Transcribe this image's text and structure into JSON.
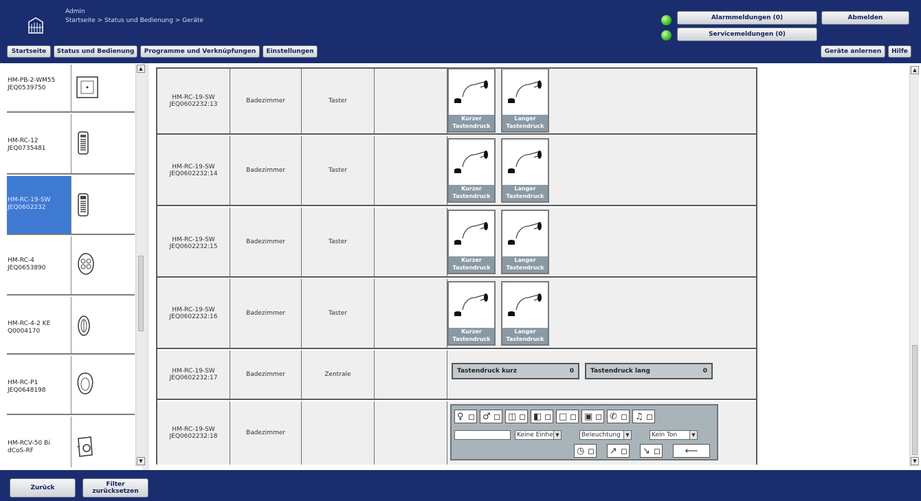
{
  "header": {
    "user": "Admin",
    "breadcrumb": "Startseite > Status und Bedienung > Geräte",
    "alarm_label": "Alarmmeldungen (0)",
    "service_label": "Servicemeldungen (0)",
    "logout_label": "Abmelden",
    "status_color": "#3cbc23"
  },
  "nav": {
    "items": [
      "Startseite",
      "Status und Bedienung",
      "Programme und Verknüpfungen",
      "Einstellungen"
    ],
    "teach_label": "Geräte anlernen",
    "help_label": "Hilfe"
  },
  "devices": [
    {
      "name": "HM-PB-2-WM55\nJEQ0539750",
      "icon": "wall-switch-icon",
      "selected": false
    },
    {
      "name": "HM-RC-12\nJEQ0735481",
      "icon": "remote-12-icon",
      "selected": false
    },
    {
      "name": "HM-RC-19-SW\nJEQ0602232",
      "icon": "remote-19-icon",
      "selected": true
    },
    {
      "name": "HM-RC-4\nJEQ0653890",
      "icon": "keyfob-4-icon",
      "selected": false
    },
    {
      "name": "HM-RC-4-2 KE\nQ0004170",
      "icon": "keyfob-ke-icon",
      "selected": false
    },
    {
      "name": "HM-RC-P1\nJEQ0648198",
      "icon": "panic-button-icon",
      "selected": false
    },
    {
      "name": "HM-RCV-50 Bi\ndCoS-RF",
      "icon": "virtual-remote-icon",
      "selected": false
    }
  ],
  "rows": [
    {
      "channel": "HM-RC-19-SW\nJEQ0602232:13",
      "room": "Badezimmer",
      "type": "Taster",
      "control": "keys"
    },
    {
      "channel": "HM-RC-19-SW\nJEQ0602232:14",
      "room": "Badezimmer",
      "type": "Taster",
      "control": "keys"
    },
    {
      "channel": "HM-RC-19-SW\nJEQ0602232:15",
      "room": "Badezimmer",
      "type": "Taster",
      "control": "keys"
    },
    {
      "channel": "HM-RC-19-SW\nJEQ0602232:16",
      "room": "Badezimmer",
      "type": "Taster",
      "control": "keys"
    },
    {
      "channel": "HM-RC-19-SW\nJEQ0602232:17",
      "room": "Badezimmer",
      "type": "Zentrale",
      "control": "status"
    },
    {
      "channel": "HM-RC-19-SW\nJEQ0602232:18",
      "room": "Badezimmer",
      "type": "",
      "control": "display"
    }
  ],
  "keys": {
    "short_label": "Kurzer\nTastendruck",
    "long_label": "Langer\nTastendruck"
  },
  "status": {
    "short_label": "Tastendruck kurz",
    "short_value": "0",
    "long_label": "Tastendruck lang",
    "long_value": "0"
  },
  "display": {
    "unit_select": "Keine Einhei",
    "light_select": "Beleuchtung",
    "sound_select": "Kein Ton",
    "text_value": ""
  },
  "footer": {
    "back_label": "Zurück",
    "filter_label": "Filter\nzurücksetzen"
  }
}
